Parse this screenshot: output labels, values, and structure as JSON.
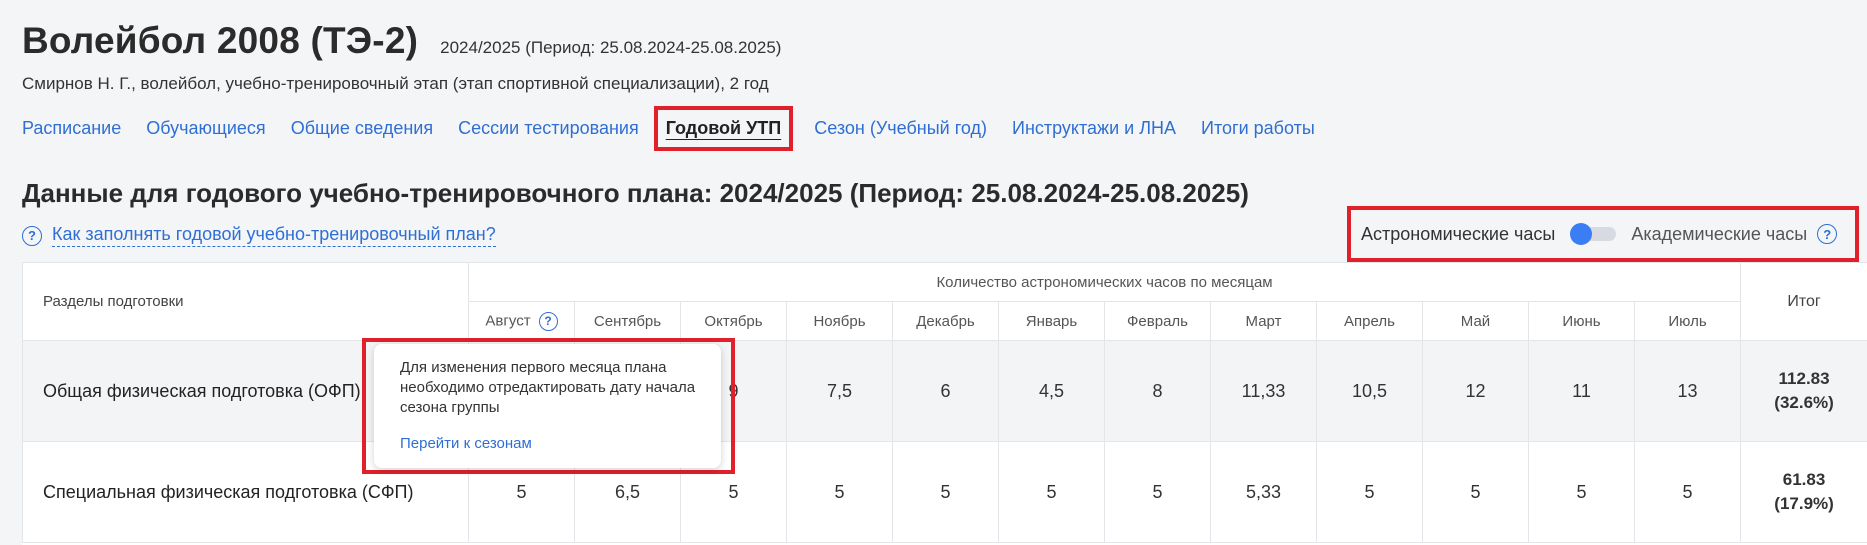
{
  "header": {
    "title": "Волейбол 2008 (ТЭ-2)",
    "period": "2024/2025 (Период: 25.08.2024-25.08.2025)",
    "subtitle": "Смирнов Н. Г., волейбол, учебно-тренировочный этап (этап спортивной специализации), 2 год"
  },
  "tabs": [
    {
      "label": "Расписание"
    },
    {
      "label": "Обучающиеся"
    },
    {
      "label": "Общие сведения"
    },
    {
      "label": "Сессии тестирования"
    },
    {
      "label": "Годовой УТП",
      "active": true
    },
    {
      "label": "Сезон (Учебный год)"
    },
    {
      "label": "Инструктажи и ЛНА"
    },
    {
      "label": "Итоги работы"
    }
  ],
  "section_title": "Данные для годового учебно-тренировочного плана: 2024/2025 (Период: 25.08.2024-25.08.2025)",
  "help_link": "Как заполнять годовой учебно-тренировочный план?",
  "hours_toggle": {
    "left_label": "Астрономические часы",
    "right_label": "Академические часы",
    "selected": "Астрономические часы"
  },
  "table": {
    "sections_header": "Разделы подготовки",
    "months_group_header": "Количество астрономических часов по месяцам",
    "total_header": "Итог",
    "months": [
      "Август",
      "Сентябрь",
      "Октябрь",
      "Ноябрь",
      "Декабрь",
      "Январь",
      "Февраль",
      "Март",
      "Апрель",
      "Май",
      "Июнь",
      "Июль"
    ],
    "rows": [
      {
        "name": "Общая физическая подготовка (ОФП)",
        "values": [
          "",
          "",
          "9",
          "7,5",
          "6",
          "4,5",
          "8",
          "11,33",
          "10,5",
          "12",
          "11",
          "13"
        ],
        "total": "112.83",
        "total_pct": "(32.6%)"
      },
      {
        "name": "Специальная физическая подготовка (СФП)",
        "values": [
          "5",
          "6,5",
          "5",
          "5",
          "5",
          "5",
          "5",
          "5,33",
          "5",
          "5",
          "5",
          "5"
        ],
        "total": "61.83",
        "total_pct": "(17.9%)"
      }
    ]
  },
  "tooltip": {
    "text": "Для изменения первого месяца плана необходимо отредактировать дату начала сезона группы",
    "link": "Перейти к сезонам"
  },
  "colors": {
    "accent_blue": "#2f6fd4",
    "highlight_red": "#e0202a",
    "toggle_knob": "#3a7df5"
  },
  "icons": [
    "question-circle-icon"
  ]
}
